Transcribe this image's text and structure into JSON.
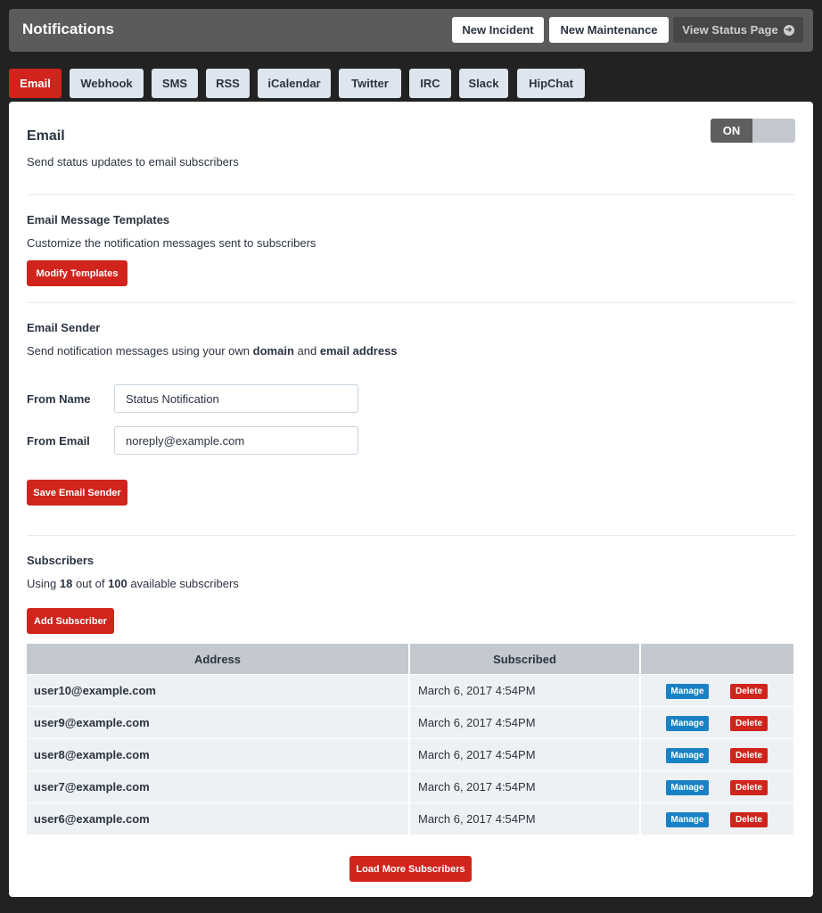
{
  "header": {
    "title": "Notifications",
    "new_incident": "New Incident",
    "new_maintenance": "New Maintenance",
    "view_status_page": "View Status Page",
    "view_status_icon": "arrow-circle-right-icon"
  },
  "tabs": [
    {
      "label": "Email",
      "active": true
    },
    {
      "label": "Webhook"
    },
    {
      "label": "SMS"
    },
    {
      "label": "RSS"
    },
    {
      "label": "iCalendar"
    },
    {
      "label": "Twitter"
    },
    {
      "label": "IRC"
    },
    {
      "label": "Slack"
    },
    {
      "label": "HipChat"
    }
  ],
  "email": {
    "title": "Email",
    "description": "Send status updates to email subscribers",
    "toggle_label": "ON"
  },
  "templates": {
    "title": "Email Message Templates",
    "description": "Customize the notification messages sent to subscribers",
    "button": "Modify Templates"
  },
  "sender": {
    "title": "Email Sender",
    "desc_prefix": "Send notification messages using your own ",
    "desc_domain": "domain",
    "desc_and": " and ",
    "desc_email": "email address",
    "from_name_label": "From Name",
    "from_name_value": "Status Notification",
    "from_email_label": "From Email",
    "from_email_value": "noreply@example.com",
    "save_button": "Save Email Sender"
  },
  "subscribers": {
    "title": "Subscribers",
    "usage_prefix": "Using ",
    "used": "18",
    "usage_mid": " out of ",
    "total": "100",
    "usage_suffix": " available subscribers",
    "add_button": "Add Subscriber",
    "columns": [
      "Address",
      "Subscribed",
      ""
    ],
    "rows": [
      {
        "address": "user10@example.com",
        "subscribed": "March 6, 2017 4:54PM"
      },
      {
        "address": "user9@example.com",
        "subscribed": "March 6, 2017 4:54PM"
      },
      {
        "address": "user8@example.com",
        "subscribed": "March 6, 2017 4:54PM"
      },
      {
        "address": "user7@example.com",
        "subscribed": "March 6, 2017 4:54PM"
      },
      {
        "address": "user6@example.com",
        "subscribed": "March 6, 2017 4:54PM"
      }
    ],
    "manage_label": "Manage",
    "delete_label": "Delete",
    "load_more": "Load More Subscribers"
  },
  "colors": {
    "accent_red": "#d0241c",
    "manage_blue": "#1a82c4",
    "header_bg": "#5b5b5b",
    "page_bg": "#222222"
  }
}
